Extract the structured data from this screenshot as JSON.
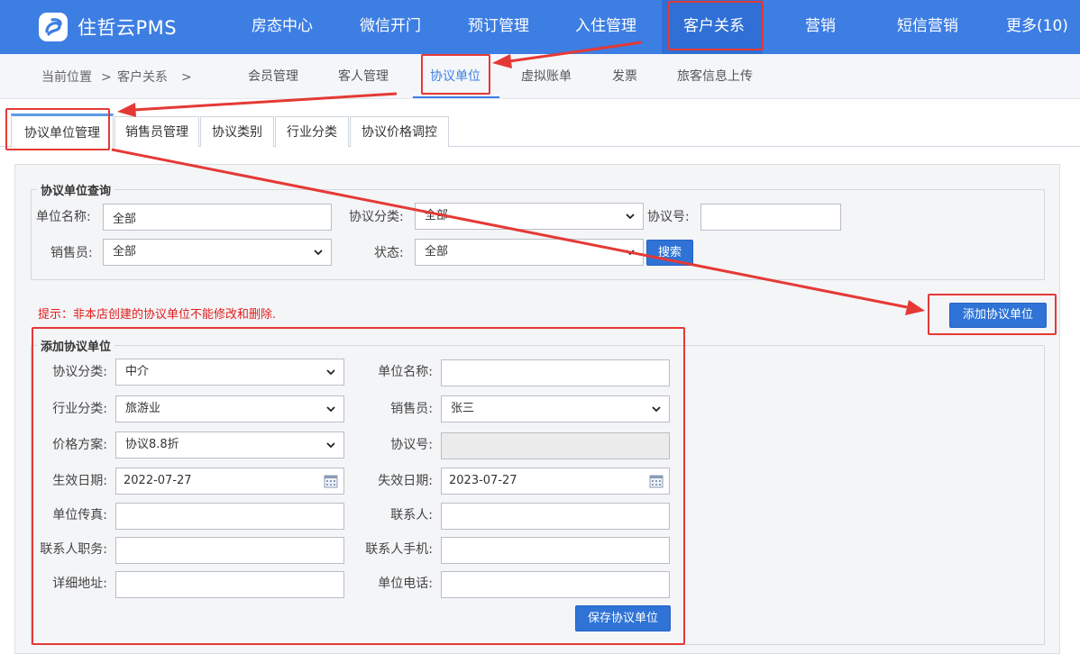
{
  "app": {
    "name": "住哲云PMS"
  },
  "topnav": {
    "items": [
      {
        "label": "房态中心"
      },
      {
        "label": "微信开门"
      },
      {
        "label": "预订管理"
      },
      {
        "label": "入住管理"
      },
      {
        "label": "客户关系"
      },
      {
        "label": "营销"
      },
      {
        "label": "短信营销"
      },
      {
        "label": "更多(10)"
      }
    ],
    "active": "客户关系"
  },
  "breadcrumb": {
    "prefix": "当前位置",
    "current": "客户关系",
    "sep": ">"
  },
  "subnav": {
    "items": [
      {
        "label": "会员管理"
      },
      {
        "label": "客人管理"
      },
      {
        "label": "协议单位"
      },
      {
        "label": "虚拟账单"
      },
      {
        "label": "发票"
      },
      {
        "label": "旅客信息上传"
      }
    ],
    "active": "协议单位"
  },
  "tabs": {
    "items": [
      {
        "label": "协议单位管理"
      },
      {
        "label": "销售员管理"
      },
      {
        "label": "协议类别"
      },
      {
        "label": "行业分类"
      },
      {
        "label": "协议价格调控"
      }
    ],
    "active": "协议单位管理"
  },
  "query": {
    "title": "协议单位查询",
    "unit_name": {
      "label": "单位名称:",
      "value": "全部"
    },
    "category": {
      "label": "协议分类:",
      "value": "全部"
    },
    "agreement_no": {
      "label": "协议号:",
      "value": ""
    },
    "salesperson": {
      "label": "销售员:",
      "value": "全部"
    },
    "status": {
      "label": "状态:",
      "value": "全部"
    },
    "search_label": "搜索"
  },
  "hint": "提示：非本店创建的协议单位不能修改和删除.",
  "add_button_label": "添加协议单位",
  "form": {
    "title": "添加协议单位",
    "category": {
      "label": "协议分类:",
      "value": "中介"
    },
    "unit_name": {
      "label": "单位名称:",
      "value": ""
    },
    "industry": {
      "label": "行业分类:",
      "value": "旅游业"
    },
    "salesperson": {
      "label": "销售员:",
      "value": "张三"
    },
    "price_plan": {
      "label": "价格方案:",
      "value": "协议8.8折"
    },
    "agreement_no": {
      "label": "协议号:",
      "value": ""
    },
    "start_date": {
      "label": "生效日期:",
      "value": "2022-07-27"
    },
    "end_date": {
      "label": "失效日期:",
      "value": "2023-07-27"
    },
    "fax": {
      "label": "单位传真:",
      "value": ""
    },
    "contact": {
      "label": "联系人:",
      "value": ""
    },
    "contact_title": {
      "label": "联系人职务:",
      "value": ""
    },
    "contact_mobile": {
      "label": "联系人手机:",
      "value": ""
    },
    "address": {
      "label": "详细地址:",
      "value": ""
    },
    "phone": {
      "label": "单位电话:",
      "value": ""
    },
    "save_label": "保存协议单位"
  },
  "colors": {
    "topbar": "#3d7ee3",
    "button": "#2f73d6",
    "annotation": "#e53935",
    "hint": "#e11c1c"
  }
}
